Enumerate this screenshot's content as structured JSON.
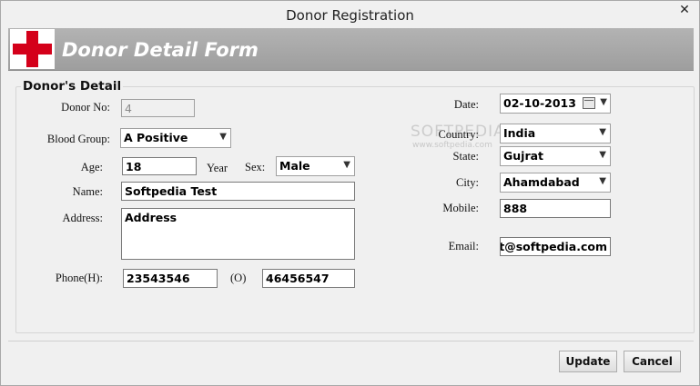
{
  "window": {
    "title": "Donor Registration",
    "close_glyph": "✕"
  },
  "banner": {
    "title": "Donor Detail Form",
    "logo_icon": "red-cross-icon"
  },
  "group": {
    "legend": "Donor's Detail"
  },
  "fields": {
    "donor_no": {
      "label": "Donor No:",
      "value": "4"
    },
    "blood_group": {
      "label": "Blood Group:",
      "value": "A Positive"
    },
    "age": {
      "label": "Age:",
      "value": "18",
      "unit": "Year"
    },
    "sex": {
      "label": "Sex:",
      "value": "Male"
    },
    "name": {
      "label": "Name:",
      "value": "Softpedia Test"
    },
    "address": {
      "label": "Address:",
      "value": "Address"
    },
    "phone_h": {
      "label": "Phone(H):",
      "value": "23543546"
    },
    "phone_o": {
      "label": "(O)",
      "value": "46456547"
    },
    "date": {
      "label": "Date:",
      "value": "02-10-2013"
    },
    "country": {
      "label": "Country:",
      "value": "India"
    },
    "state": {
      "label": "State:",
      "value": "Gujrat"
    },
    "city": {
      "label": "City:",
      "value": "Ahamdabad"
    },
    "mobile": {
      "label": "Mobile:",
      "value": "888"
    },
    "email": {
      "label": "Email:",
      "value": "est@softpedia.com"
    }
  },
  "watermark": {
    "text": "SOFTPEDIA",
    "sub": "www.softpedia.com"
  },
  "buttons": {
    "update": "Update",
    "cancel": "Cancel"
  }
}
